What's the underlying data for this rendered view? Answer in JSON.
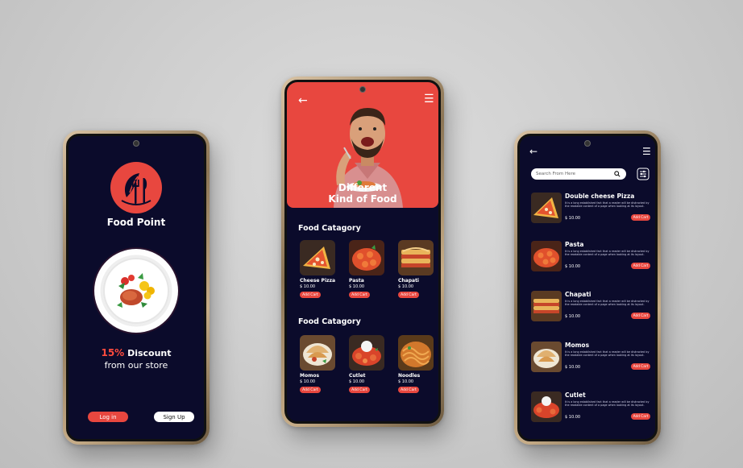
{
  "colors": {
    "accent": "#e8473f",
    "screen_bg": "#0b0b2b",
    "discount": "#ff4b3e"
  },
  "welcome": {
    "brand": "Food Point",
    "discount_pct": "15%",
    "discount_text": "Discount",
    "discount_sub": "from our store",
    "login_label": "Log in",
    "signup_label": "Sign Up"
  },
  "home": {
    "hero_line1": "Different",
    "hero_line2": "Kind of Food",
    "sections": [
      {
        "title": "Food Catagory",
        "items": [
          {
            "name": "Cheese Pizza",
            "price": "$ 10.00",
            "cart": "Add Cart"
          },
          {
            "name": "Pasta",
            "price": "$ 10.00",
            "cart": "Add Cart"
          },
          {
            "name": "Chapati",
            "price": "$ 10.00",
            "cart": "Add Cart"
          }
        ]
      },
      {
        "title": "Food Catagory",
        "items": [
          {
            "name": "Momos",
            "price": "$ 10.00",
            "cart": "Add Cart"
          },
          {
            "name": "Cutlet",
            "price": "$ 10.00",
            "cart": "Add Cart"
          },
          {
            "name": "Noodles",
            "price": "$ 10.00",
            "cart": "Add Cart"
          }
        ]
      }
    ]
  },
  "list": {
    "search_placeholder": "Search From Here",
    "items": [
      {
        "name": "Double cheese Pizza",
        "desc": "It is a long established fact that a reader will be distracted by the readable content of a page when looking at its layout.",
        "price": "$ 10.00",
        "cart": "Add Cart"
      },
      {
        "name": "Pasta",
        "desc": "It is a long established fact that a reader will be distracted by the readable content of a page when looking at its layout.",
        "price": "$ 10.00",
        "cart": "Add Cart"
      },
      {
        "name": "Chapati",
        "desc": "It is a long established fact that a reader will be distracted by the readable content of a page when looking at its layout.",
        "price": "$ 10.00",
        "cart": "Add Cart"
      },
      {
        "name": "Momos",
        "desc": "It is a long established fact that a reader will be distracted by the readable content of a page when looking at its layout.",
        "price": "$ 10.00",
        "cart": "Add Cart"
      },
      {
        "name": "Cutlet",
        "desc": "It is a long established fact that a reader will be distracted by the readable content of a page when looking at its layout.",
        "price": "$ 10.00",
        "cart": "Add Cart"
      }
    ]
  }
}
